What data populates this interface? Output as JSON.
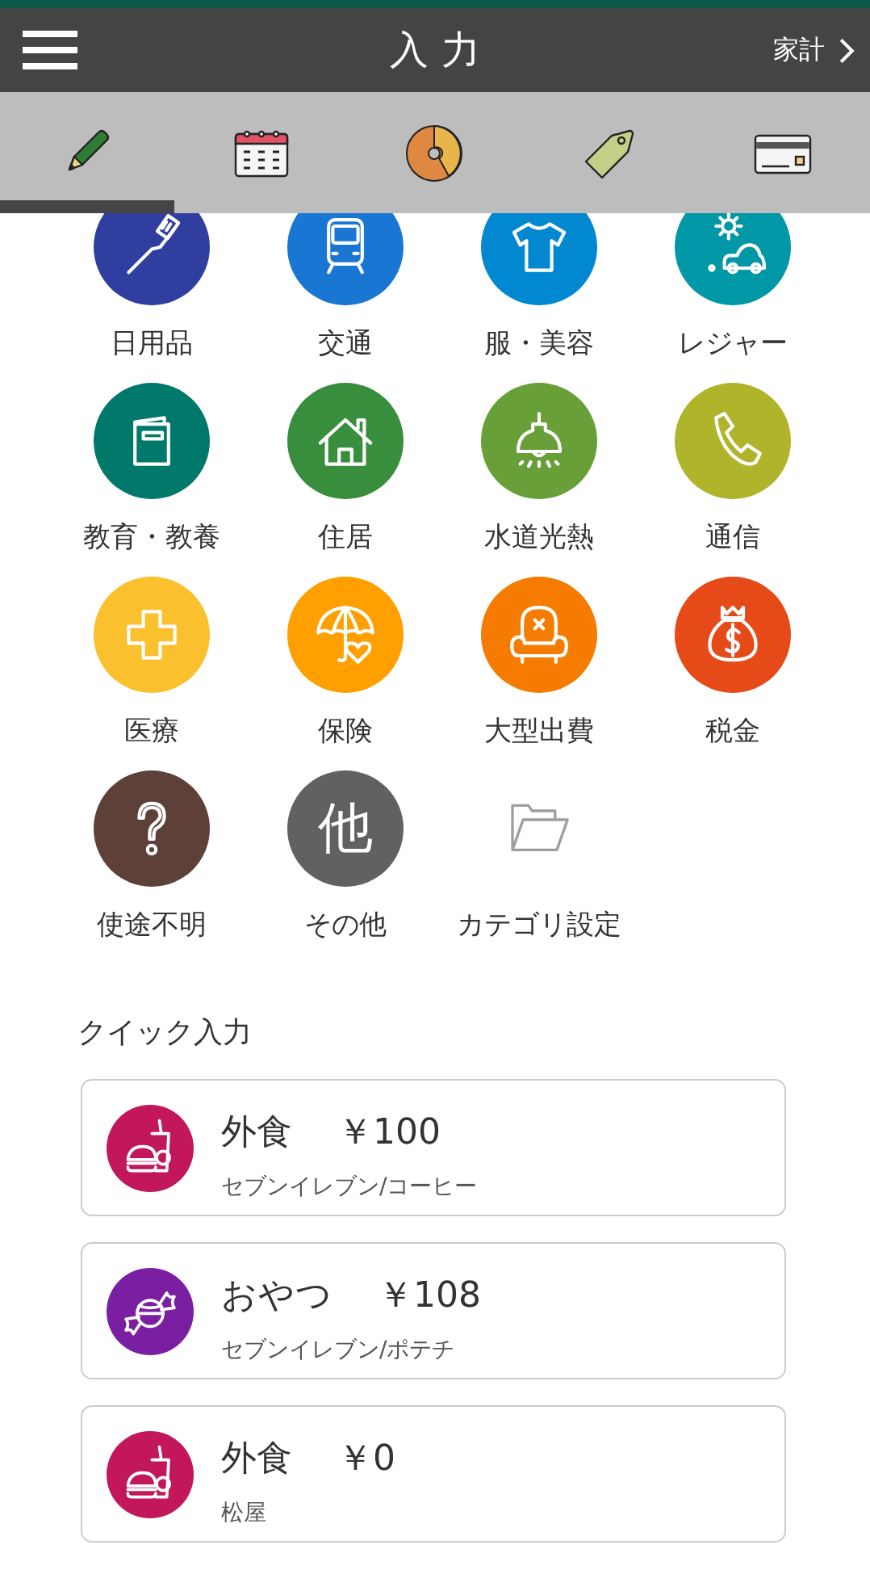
{
  "header": {
    "title": "入力",
    "link": "家計"
  },
  "tabs": [
    {
      "selected": true
    },
    {
      "selected": false
    },
    {
      "selected": false
    },
    {
      "selected": false
    },
    {
      "selected": false
    }
  ],
  "categories": [
    {
      "kind": "category",
      "label": "日用品",
      "color": "#303f9f"
    },
    {
      "kind": "category",
      "label": "交通",
      "color": "#1976d2"
    },
    {
      "kind": "category",
      "label": "服・美容",
      "color": "#0288d1"
    },
    {
      "kind": "category",
      "label": "レジャー",
      "color": "#0097a7"
    },
    {
      "kind": "category",
      "label": "教育・教養",
      "color": "#00796b"
    },
    {
      "kind": "category",
      "label": "住居",
      "color": "#388e3c"
    },
    {
      "kind": "category",
      "label": "水道光熱",
      "color": "#689f38"
    },
    {
      "kind": "category",
      "label": "通信",
      "color": "#afb42b"
    },
    {
      "kind": "category",
      "label": "医療",
      "color": "#fbc02d"
    },
    {
      "kind": "category",
      "label": "保険",
      "color": "#ffa000"
    },
    {
      "kind": "category",
      "label": "大型出費",
      "color": "#f57c00"
    },
    {
      "kind": "category",
      "label": "税金",
      "color": "#e64a19"
    },
    {
      "kind": "category",
      "label": "使途不明",
      "color": "#5d4037"
    },
    {
      "kind": "glyph",
      "glyph": "他",
      "label": "その他",
      "color": "#616161"
    },
    {
      "kind": "settings",
      "label": "カテゴリ設定"
    }
  ],
  "quick_input": {
    "title": "クイック入力",
    "items": [
      {
        "kind": "food",
        "color": "#c2185b",
        "category": "外食",
        "amount": "￥100",
        "memo": "セブンイレブン/コーヒー"
      },
      {
        "kind": "candy",
        "color": "#7b1fa2",
        "category": "おやつ",
        "amount": "￥108",
        "memo": "セブンイレブン/ポテチ"
      },
      {
        "kind": "food",
        "color": "#c2185b",
        "category": "外食",
        "amount": "￥0",
        "memo": "松屋"
      }
    ]
  }
}
